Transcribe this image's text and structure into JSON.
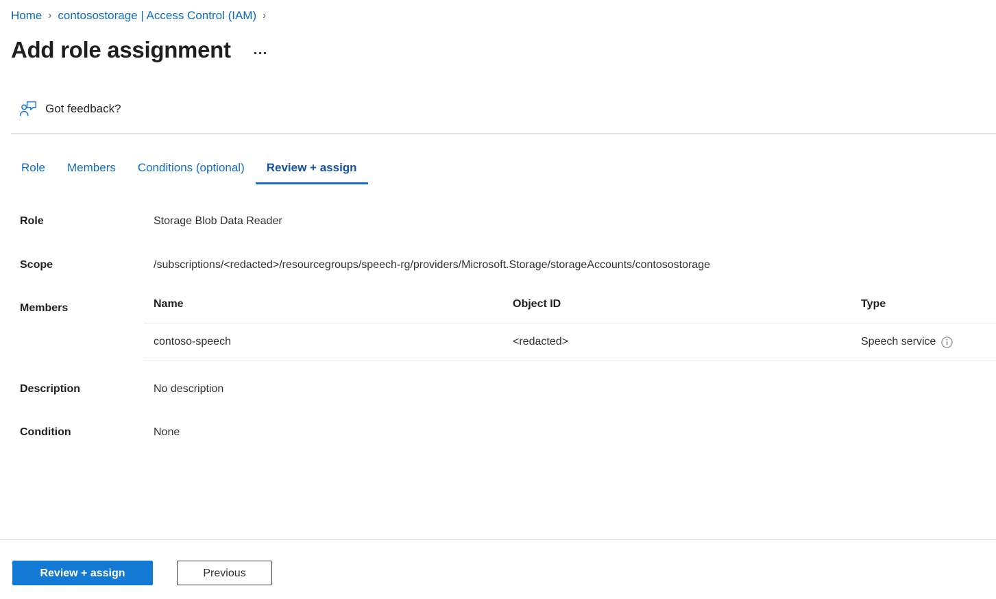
{
  "breadcrumb": {
    "items": [
      {
        "label": "Home"
      },
      {
        "label": "contosostorage | Access Control (IAM)"
      }
    ],
    "separator": "›"
  },
  "header": {
    "title": "Add role assignment",
    "more_menu": "···"
  },
  "feedback": {
    "label": "Got feedback?",
    "icon": "feedback-person-icon"
  },
  "tabs": [
    {
      "label": "Role",
      "active": false
    },
    {
      "label": "Members",
      "active": false
    },
    {
      "label": "Conditions (optional)",
      "active": false
    },
    {
      "label": "Review + assign",
      "active": true
    }
  ],
  "summary": {
    "role_label": "Role",
    "role_value": "Storage Blob Data Reader",
    "scope_label": "Scope",
    "scope_value": "/subscriptions/<redacted>/resourcegroups/speech-rg/providers/Microsoft.Storage/storageAccounts/contosostorage",
    "members_label": "Members",
    "description_label": "Description",
    "description_value": "No description",
    "condition_label": "Condition",
    "condition_value": "None"
  },
  "members_table": {
    "columns": [
      "Name",
      "Object ID",
      "Type"
    ],
    "rows": [
      {
        "name": "contoso-speech",
        "object_id": "<redacted>",
        "type": "Speech service",
        "type_info_icon": "info-icon"
      }
    ]
  },
  "footer": {
    "primary_label": "Review + assign",
    "secondary_label": "Previous"
  },
  "colors": {
    "link": "#0f6cbd",
    "accent": "#1279d4",
    "active_tab": "#1352a6",
    "text": "#201f1e",
    "divider": "#e1dfdd"
  }
}
